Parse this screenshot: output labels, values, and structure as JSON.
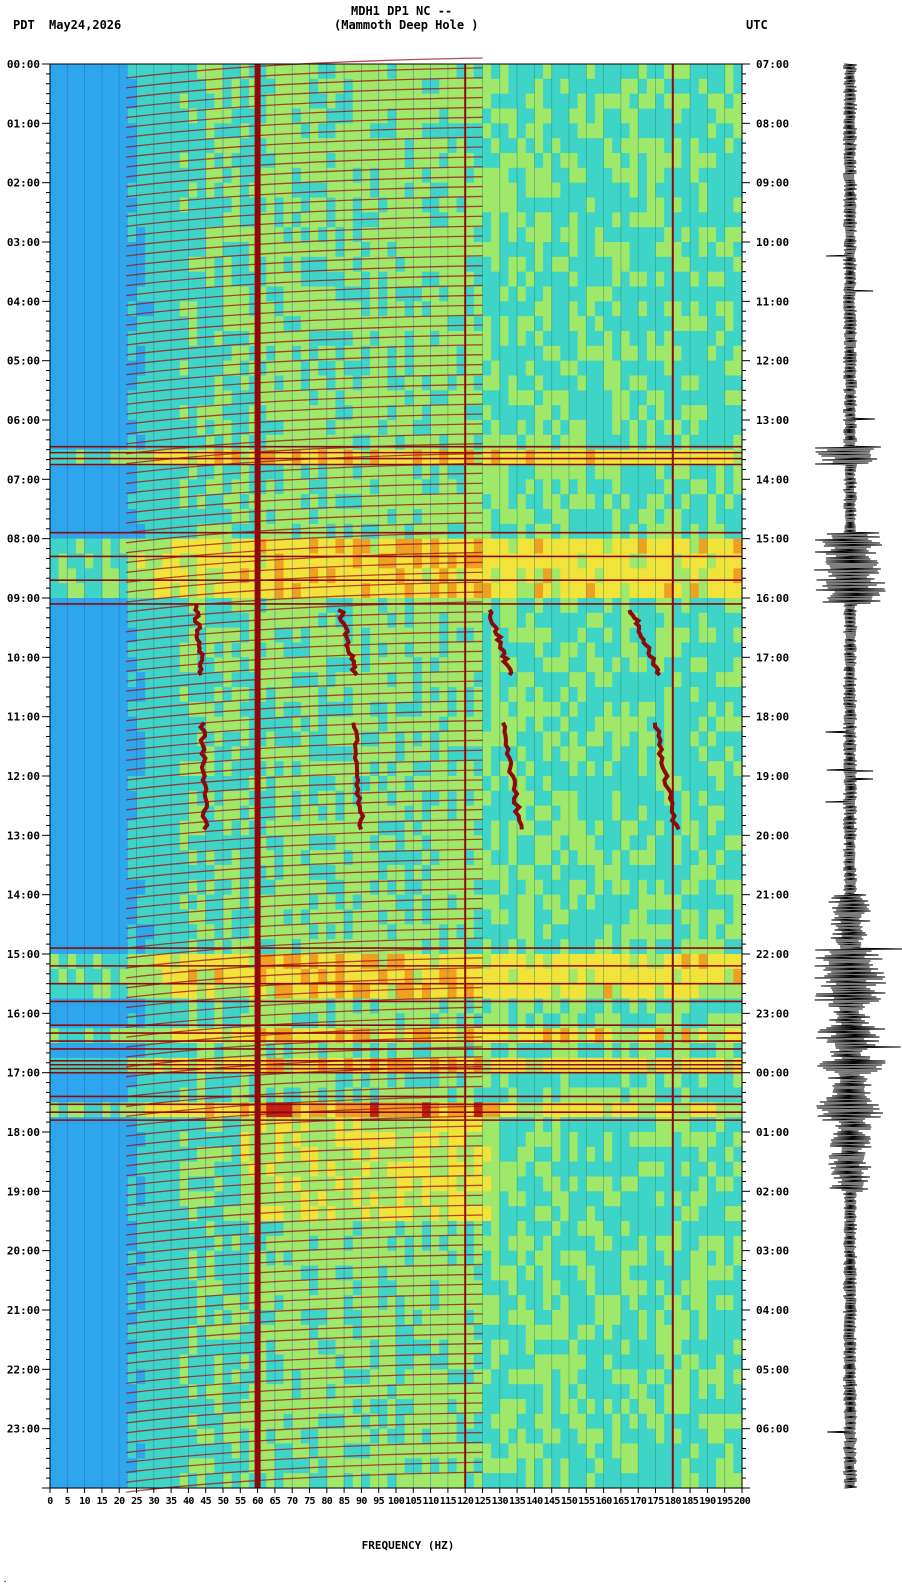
{
  "header": {
    "station": "MDH1 DP1 NC --",
    "location": "(Mammoth Deep Hole )",
    "left_tz": "PDT",
    "date": "May24,2026",
    "right_tz": "UTC"
  },
  "chart_data": {
    "type": "heatmap",
    "title": "MDH1 DP1 NC --",
    "subtitle": "(Mammoth Deep Hole )",
    "xlabel": "FREQUENCY (HZ)",
    "xlim": [
      0,
      200
    ],
    "x_ticks": [
      "0",
      "5",
      "10",
      "15",
      "20",
      "25",
      "30",
      "35",
      "40",
      "45",
      "50",
      "55",
      "60",
      "65",
      "70",
      "75",
      "80",
      "85",
      "90",
      "95",
      "100",
      "105",
      "110",
      "115",
      "120",
      "125",
      "130",
      "135",
      "140",
      "145",
      "150",
      "155",
      "160",
      "165",
      "170",
      "175",
      "180",
      "185",
      "190",
      "195",
      "200"
    ],
    "y_left_ticks": [
      "00:00",
      "01:00",
      "02:00",
      "03:00",
      "04:00",
      "05:00",
      "06:00",
      "07:00",
      "08:00",
      "09:00",
      "10:00",
      "11:00",
      "12:00",
      "13:00",
      "14:00",
      "15:00",
      "16:00",
      "17:00",
      "18:00",
      "19:00",
      "20:00",
      "21:00",
      "22:00",
      "23:00"
    ],
    "y_right_ticks": [
      "07:00",
      "08:00",
      "09:00",
      "10:00",
      "11:00",
      "12:00",
      "13:00",
      "14:00",
      "15:00",
      "16:00",
      "17:00",
      "18:00",
      "19:00",
      "20:00",
      "21:00",
      "22:00",
      "23:00",
      "00:00",
      "01:00",
      "02:00",
      "03:00",
      "04:00",
      "05:00",
      "06:00"
    ],
    "ylim_hours": [
      0,
      24
    ],
    "colormap": [
      "#1e64d8",
      "#2ea6ee",
      "#3fd4c8",
      "#9fe86a",
      "#f2e33a",
      "#f0a020",
      "#c82010",
      "#8c0a0a"
    ],
    "persistent_lines_hz": [
      60,
      120,
      180
    ],
    "strong_noise_bands_hours": [
      [
        6.45,
        6.75
      ],
      [
        7.9,
        9.1
      ],
      [
        14.9,
        15.8
      ],
      [
        16.2,
        16.6
      ],
      [
        16.8,
        17.0
      ],
      [
        17.4,
        17.8
      ]
    ],
    "tremor_tracks": [
      {
        "hours": [
          9.1,
          10.3
        ],
        "hz": [
          42,
          44
        ]
      },
      {
        "hours": [
          9.2,
          10.3
        ],
        "hz": [
          84,
          88
        ]
      },
      {
        "hours": [
          9.2,
          10.3
        ],
        "hz": [
          127,
          133
        ]
      },
      {
        "hours": [
          9.2,
          10.3
        ],
        "hz": [
          168,
          176
        ]
      },
      {
        "hours": [
          11.1,
          12.9
        ],
        "hz": [
          44,
          45
        ]
      },
      {
        "hours": [
          11.1,
          12.9
        ],
        "hz": [
          88,
          90
        ]
      },
      {
        "hours": [
          11.1,
          12.9
        ],
        "hz": [
          131,
          136
        ]
      },
      {
        "hours": [
          11.1,
          12.9
        ],
        "hz": [
          175,
          181
        ]
      }
    ],
    "grid": true
  }
}
